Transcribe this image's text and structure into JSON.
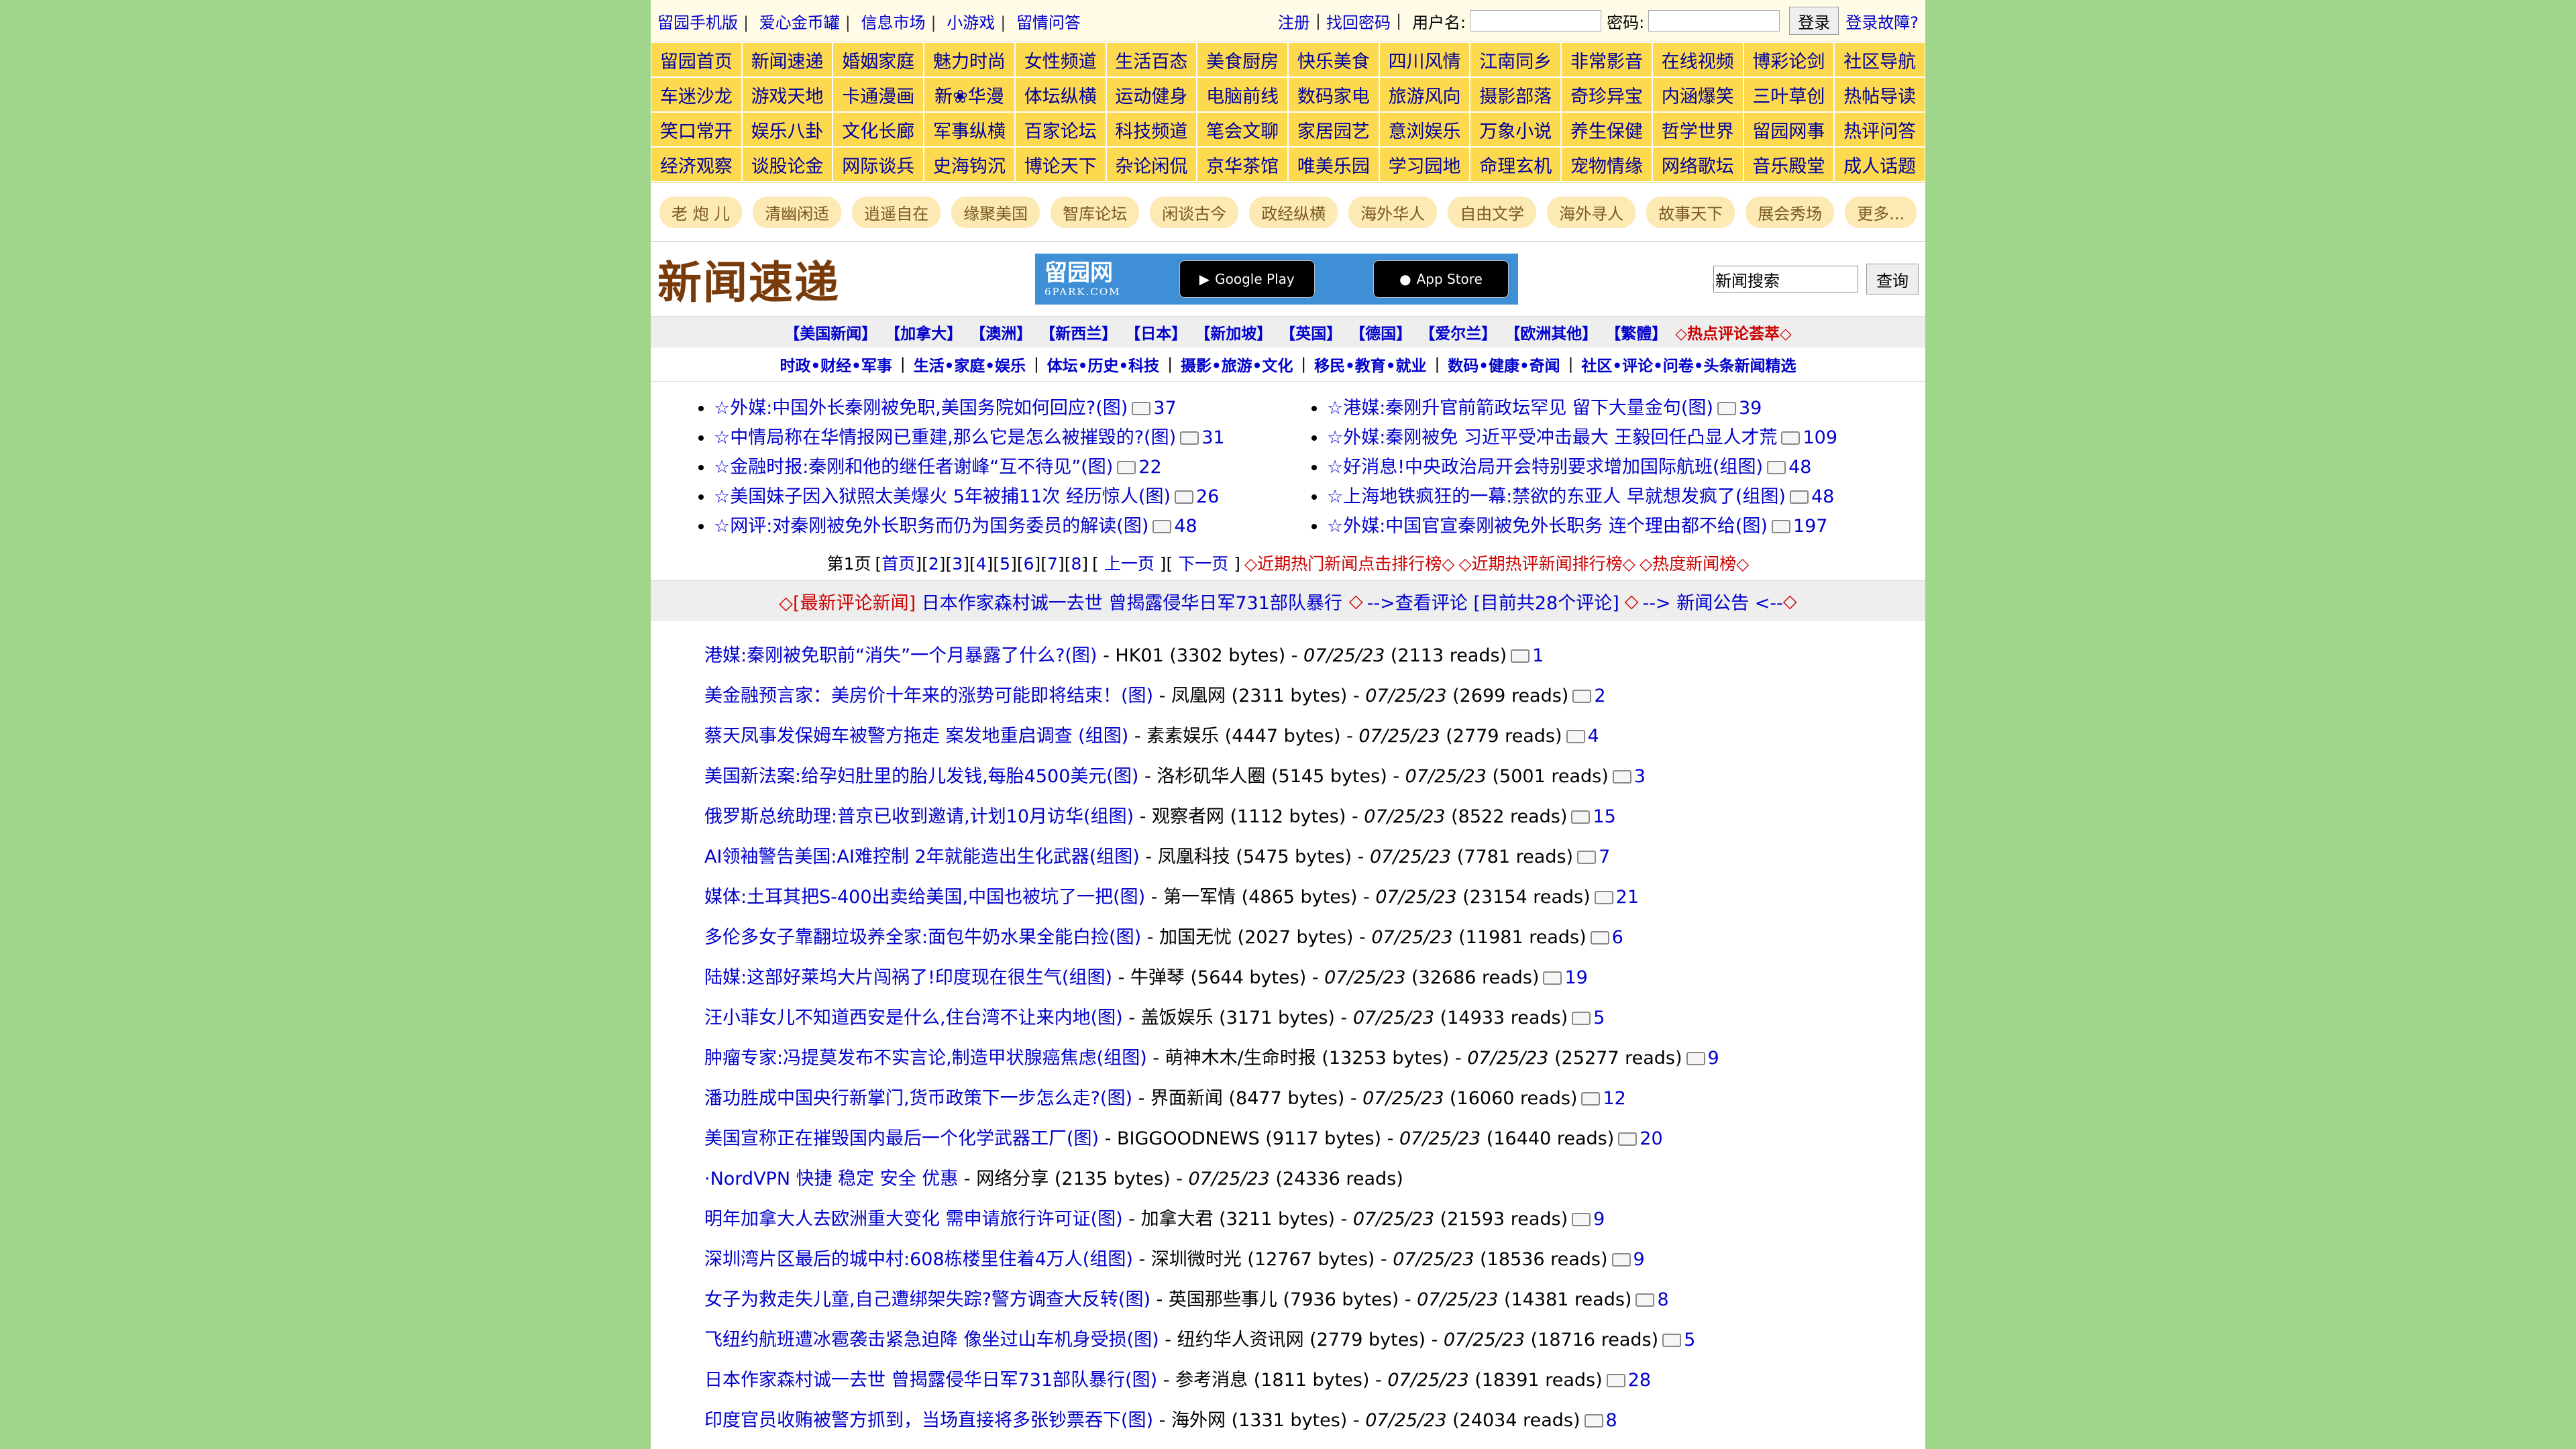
{
  "topbar": {
    "links": [
      "留园手机版",
      "爱心金币罐",
      "信息市场",
      "小游戏",
      "留情问答"
    ],
    "register": "注册",
    "find_password": "找回密码",
    "username_label": "用户名:",
    "password_label": "密码:",
    "login_button": "登录",
    "login_trouble": "登录故障?"
  },
  "nav_grid": [
    "留园首页",
    "新闻速递",
    "婚姻家庭",
    "魅力时尚",
    "女性频道",
    "生活百态",
    "美食厨房",
    "快乐美食",
    "四川风情",
    "江南同乡",
    "非常影音",
    "在线视频",
    "博彩论剑",
    "社区导航",
    "车迷沙龙",
    "游戏天地",
    "卡通漫画",
    "新❀华漫",
    "体坛纵横",
    "运动健身",
    "电脑前线",
    "数码家电",
    "旅游风向",
    "摄影部落",
    "奇珍异宝",
    "内涵爆笑",
    "三叶草创",
    "热帖导读",
    "笑口常开",
    "娱乐八卦",
    "文化长廊",
    "军事纵横",
    "百家论坛",
    "科技频道",
    "笔会文聊",
    "家居园艺",
    "意浏娱乐",
    "万象小说",
    "养生保健",
    "哲学世界",
    "留园网事",
    "热评问答",
    "经济观察",
    "谈股论金",
    "网际谈兵",
    "史海钩沉",
    "博论天下",
    "杂论闲侃",
    "京华茶馆",
    "唯美乐园",
    "学习园地",
    "命理玄机",
    "宠物情缘",
    "网络歌坛",
    "音乐殿堂",
    "成人话题"
  ],
  "tags": [
    "老 炮 儿",
    "清幽闲适",
    "逍遥自在",
    "缘聚美国",
    "智库论坛",
    "闲谈古今",
    "政经纵横",
    "海外华人",
    "自由文学",
    "海外寻人",
    "故事天下",
    "展会秀场",
    "更多..."
  ],
  "header": {
    "title": "新闻速递",
    "banner_logo": "留园网",
    "banner_sub": "6PARK.COM",
    "google_play": "Google Play",
    "app_store": "App Store",
    "search_value": "新闻搜索",
    "search_button": "查询"
  },
  "regions": [
    "【美国新闻】",
    "【加拿大】",
    "【澳洲】",
    "【新西兰】",
    "【日本】",
    "【新加坡】",
    "【英国】",
    "【德国】",
    "【爱尔兰】",
    "【欧洲其他】",
    "【繁體】"
  ],
  "regions_hot": "◇热点评论荟萃◇",
  "categories": [
    "时政•财经•军事",
    "生活•家庭•娱乐",
    "体坛•历史•科技",
    "摄影•旅游•文化",
    "移民•教育•就业",
    "数码•健康•奇闻",
    "社区•评论•问卷•头条新闻精选"
  ],
  "hot_left": [
    {
      "title": "☆外媒:中国外长秦刚被免职,美国务院如何回应?(图)",
      "comments": "37"
    },
    {
      "title": "☆中情局称在华情报网已重建,那么它是怎么被摧毁的?(图)",
      "comments": "31"
    },
    {
      "title": "☆金融时报:秦刚和他的继任者谢峰“互不待见”(图)",
      "comments": "22"
    },
    {
      "title": "☆美国妹子因入狱照太美爆火 5年被捕11次 经历惊人(图)",
      "comments": "26"
    },
    {
      "title": "☆网评:对秦刚被免外长职务而仍为国务委员的解读(图)",
      "comments": "48"
    }
  ],
  "hot_right": [
    {
      "title": "☆港媒:秦刚升官前箭政坛罕见 留下大量金句(图)",
      "comments": "39"
    },
    {
      "title": "☆外媒:秦刚被免 习近平受冲击最大 王毅回任凸显人才荒",
      "comments": "109"
    },
    {
      "title": "☆好消息!中央政治局开会特别要求增加国际航班(组图)",
      "comments": "48"
    },
    {
      "title": "☆上海地铁疯狂的一幕:禁欲的东亚人 早就想发疯了(组图)",
      "comments": "48"
    },
    {
      "title": "☆外媒:中国官宣秦刚被免外长职务 连个理由都不给(图)",
      "comments": "197"
    }
  ],
  "pager": {
    "current": "第1页",
    "pages": [
      "首页",
      "2",
      "3",
      "4",
      "5",
      "6",
      "7",
      "8"
    ],
    "prev": "上一页",
    "next": "下一页",
    "rank1": "◇近期热门新闻点击排行榜◇",
    "rank2": "◇近期热评新闻排行榜◇",
    "rank3": "◇热度新闻榜◇"
  },
  "announce": {
    "latest": "◇[最新评论新闻]",
    "headline": "日本作家森村诚一去世 曾揭露侵华日军731部队暴行",
    "view": "◇ -->查看评论",
    "count": "[目前共28个评论]",
    "notice": "◇ --> 新闻公告 <--◇"
  },
  "news": [
    {
      "title": "港媒:秦刚被免职前“消失”一个月暴露了什么?(图)",
      "source": "HK01",
      "bytes": "3302",
      "date": "07/25/23",
      "reads": "2113",
      "comments": "1"
    },
    {
      "title": "美金融预言家：美房价十年来的涨势可能即将结束！(图)",
      "source": "凤凰网",
      "bytes": "2311",
      "date": "07/25/23",
      "reads": "2699",
      "comments": "2"
    },
    {
      "title": "蔡天凤事发保姆车被警方拖走 案发地重启调查 (组图)",
      "source": "素素娱乐",
      "bytes": "4447",
      "date": "07/25/23",
      "reads": "2779",
      "comments": "4"
    },
    {
      "title": "美国新法案:给孕妇肚里的胎儿发钱,每胎4500美元(图)",
      "source": "洛杉矶华人圈",
      "bytes": "5145",
      "date": "07/25/23",
      "reads": "5001",
      "comments": "3"
    },
    {
      "title": "俄罗斯总统助理:普京已收到邀请,计划10月访华(组图)",
      "source": "观察者网",
      "bytes": "1112",
      "date": "07/25/23",
      "reads": "8522",
      "comments": "15"
    },
    {
      "title": "AI领袖警告美国:AI难控制 2年就能造出生化武器(组图)",
      "source": "凤凰科技",
      "bytes": "5475",
      "date": "07/25/23",
      "reads": "7781",
      "comments": "7"
    },
    {
      "title": "媒体:土耳其把S-400出卖给美国,中国也被坑了一把(图)",
      "source": "第一军情",
      "bytes": "4865",
      "date": "07/25/23",
      "reads": "23154",
      "comments": "21"
    },
    {
      "title": "多伦多女子靠翻垃圾养全家:面包牛奶水果全能白捡(图)",
      "source": "加国无忧",
      "bytes": "2027",
      "date": "07/25/23",
      "reads": "11981",
      "comments": "6"
    },
    {
      "title": "陆媒:这部好莱坞大片闯祸了!印度现在很生气(组图)",
      "source": "牛弹琴",
      "bytes": "5644",
      "date": "07/25/23",
      "reads": "32686",
      "comments": "19"
    },
    {
      "title": "汪小菲女儿不知道西安是什么,住台湾不让来内地(图)",
      "source": "盖饭娱乐",
      "bytes": "3171",
      "date": "07/25/23",
      "reads": "14933",
      "comments": "5"
    },
    {
      "title": "肿瘤专家:冯提莫发布不实言论,制造甲状腺癌焦虑(组图)",
      "source": "萌神木木/生命时报",
      "bytes": "13253",
      "date": "07/25/23",
      "reads": "25277",
      "comments": "9"
    },
    {
      "title": "潘功胜成中国央行新掌门,货币政策下一步怎么走?(图)",
      "source": "界面新闻",
      "bytes": "8477",
      "date": "07/25/23",
      "reads": "16060",
      "comments": "12"
    },
    {
      "title": "美国宣称正在摧毁国内最后一个化学武器工厂(图)",
      "source": "BIGGOODNEWS",
      "bytes": "9117",
      "date": "07/25/23",
      "reads": "16440",
      "comments": "20"
    },
    {
      "title": "·NordVPN 快捷 稳定 安全 优惠",
      "source": "网络分享",
      "bytes": "2135",
      "date": "07/25/23",
      "reads": "24336",
      "comments": ""
    },
    {
      "title": "明年加拿大人去欧洲重大变化 需申请旅行许可证(图)",
      "source": "加拿大君",
      "bytes": "3211",
      "date": "07/25/23",
      "reads": "21593",
      "comments": "9"
    },
    {
      "title": "深圳湾片区最后的城中村:608栋楼里住着4万人(组图)",
      "source": "深圳微时光",
      "bytes": "12767",
      "date": "07/25/23",
      "reads": "18536",
      "comments": "9"
    },
    {
      "title": "女子为救走失儿童,自己遭绑架失踪?警方调查大反转(图)",
      "source": "英国那些事儿",
      "bytes": "7936",
      "date": "07/25/23",
      "reads": "14381",
      "comments": "8"
    },
    {
      "title": "飞纽约航班遭冰雹袭击紧急迫降 像坐过山车机身受损(图)",
      "source": "纽约华人资讯网",
      "bytes": "2779",
      "date": "07/25/23",
      "reads": "18716",
      "comments": "5"
    },
    {
      "title": "日本作家森村诚一去世 曾揭露侵华日军731部队暴行(图)",
      "source": "参考消息",
      "bytes": "1811",
      "date": "07/25/23",
      "reads": "18391",
      "comments": "28"
    },
    {
      "title": "印度官员收贿被警方抓到，当场直接将多张钞票吞下(图)",
      "source": "海外网",
      "bytes": "1331",
      "date": "07/25/23",
      "reads": "24034",
      "comments": "8"
    }
  ]
}
